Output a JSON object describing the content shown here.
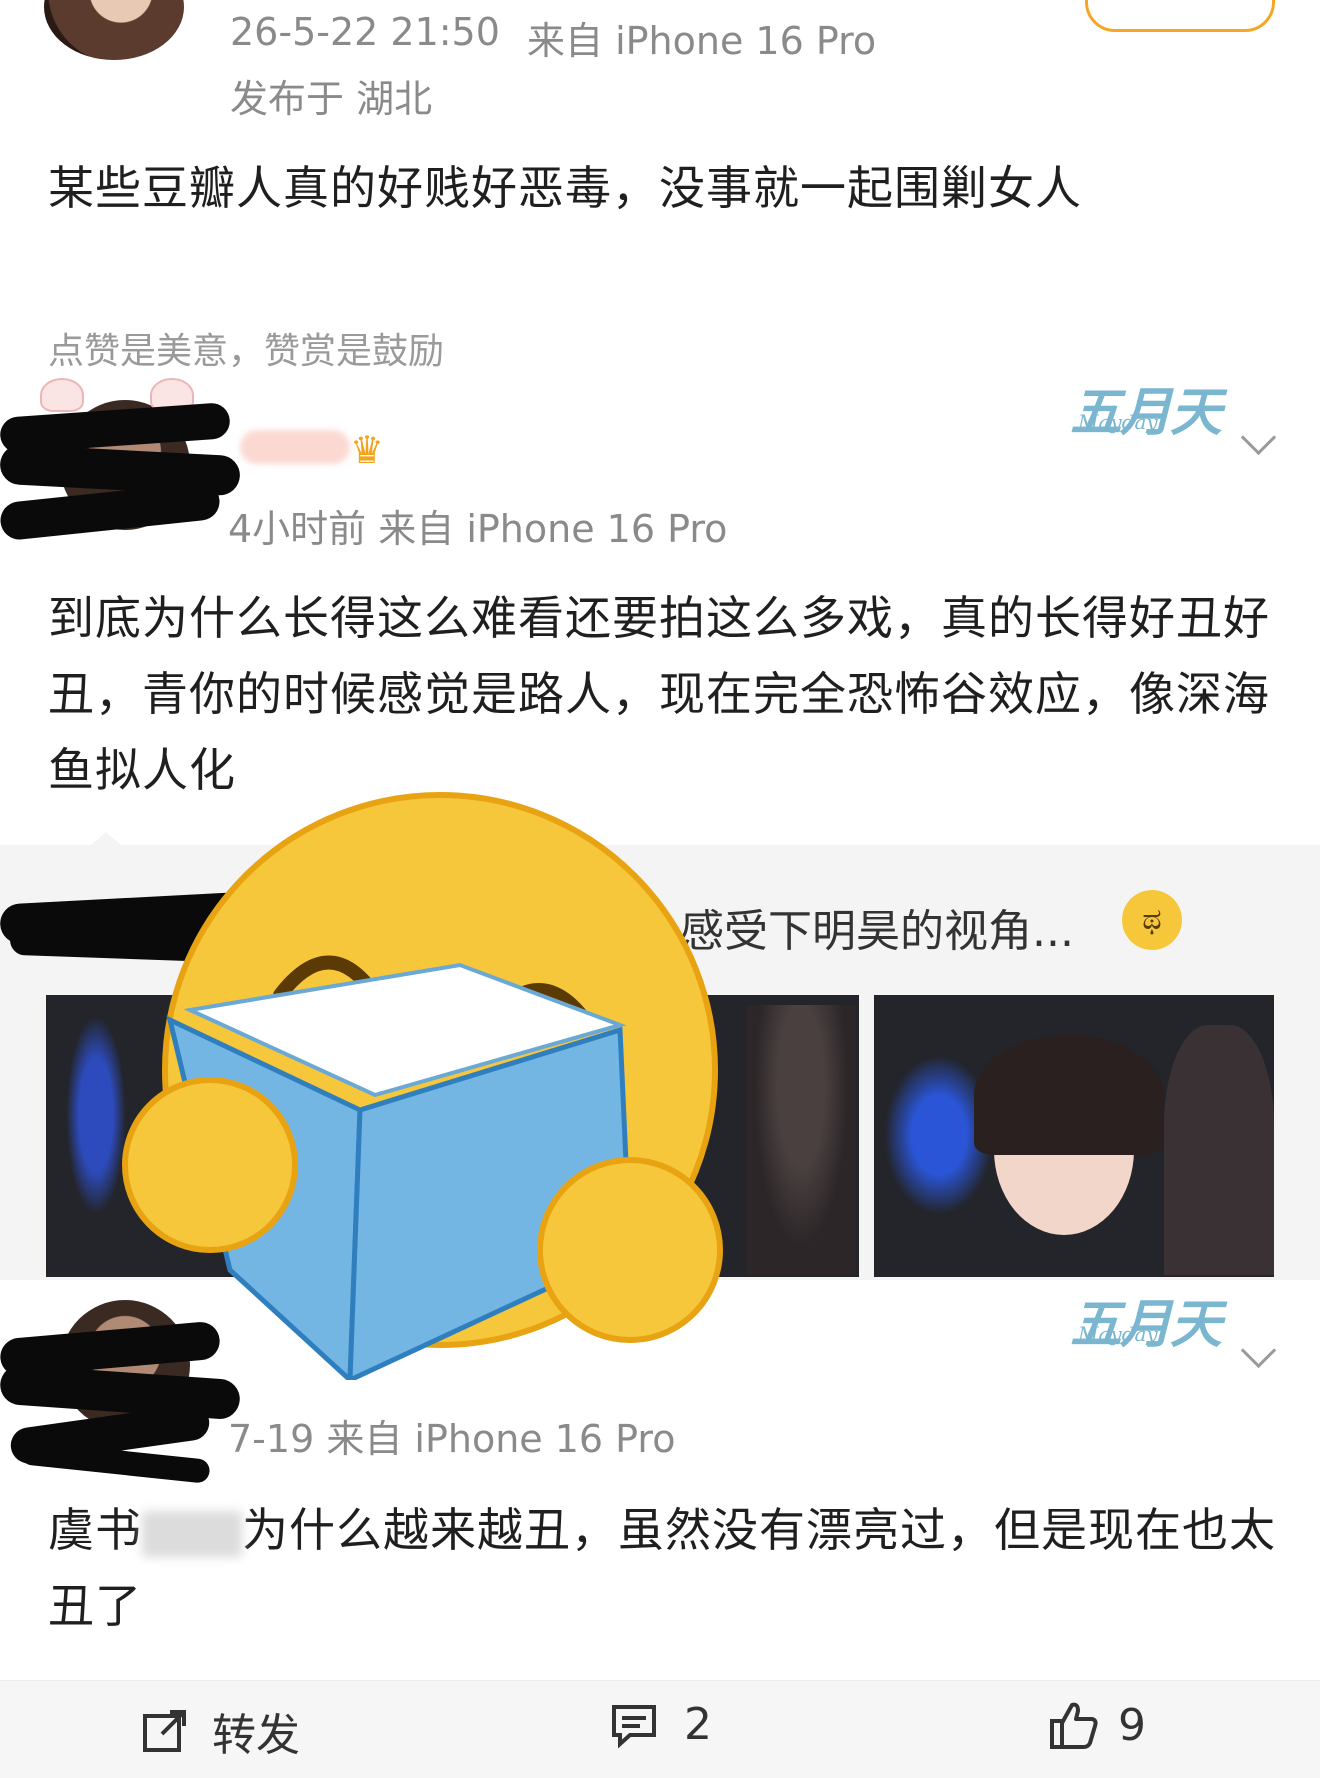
{
  "post": {
    "time": "26-5-22 21:50",
    "source": "来自 iPhone 16 Pro",
    "location": "发布于 湖北",
    "text": "某些豆瓣人真的好贱好恶毒，没事就一起围剿女人",
    "reward_hint": "点赞是美意，赞赏是鼓励"
  },
  "comments": [
    {
      "meta": "4小时前  来自 iPhone 16 Pro",
      "text": "到底为什么长得这么难看还要拍这么多戏，真的长得好丑好丑，青你的时候感觉是路人，现在完全恐怖谷效应，像深海鱼拟人化",
      "watermark": "五月天",
      "watermark_sub": "Mayday"
    },
    {
      "meta": "7-19  来自 iPhone 16 Pro",
      "text_start": "虞书",
      "text_end": "为什么越来越丑，虽然没有漂亮过，但是现在也太丑了",
      "watermark": "五月天",
      "watermark_sub": "Mayday"
    }
  ],
  "quote": {
    "text": "感受下明昊的视角..."
  },
  "footer": {
    "repost_label": "转发",
    "comment_count": "2",
    "like_count": "9"
  },
  "icons": {
    "repost": "share-icon",
    "comment": "comment-icon",
    "like": "thumbs-up-icon",
    "overlay": "reading-book-emoji-icon",
    "crying": "crying-emoji-icon"
  }
}
